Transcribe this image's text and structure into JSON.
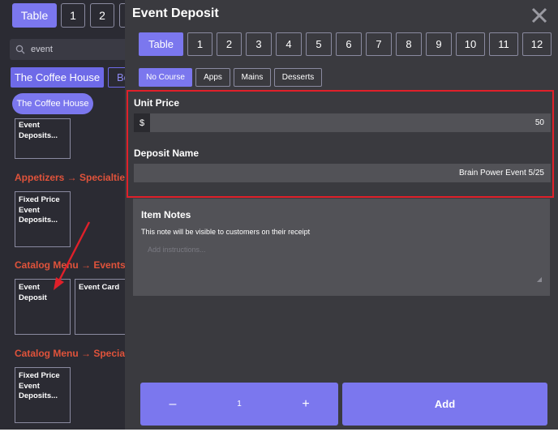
{
  "background": {
    "tabs": [
      {
        "label": "Table",
        "active": true
      },
      {
        "label": "1"
      },
      {
        "label": "2"
      }
    ],
    "search": {
      "icon": "search-icon",
      "value": "event"
    },
    "brand_button": "The Coffee House",
    "brand_button_partial": "Bo",
    "brand_pill": "The Coffee House",
    "cards": [
      {
        "label": "Event\nDeposits..."
      },
      {
        "label": "Fixed Price\nEvent\nDeposits..."
      },
      {
        "label": "Event\nDeposit"
      },
      {
        "label": "Event Card"
      },
      {
        "label": "Fixed Price\nEvent\nDeposits..."
      }
    ],
    "sections": [
      "Appetizers → Specialties",
      "Catalog Menu → Events",
      "Catalog Menu → Specialti"
    ]
  },
  "modal": {
    "title": "Event Deposit",
    "close_icon": "close-icon",
    "tabs": [
      "Table",
      "1",
      "2",
      "3",
      "4",
      "5",
      "6",
      "7",
      "8",
      "9",
      "10",
      "11",
      "12"
    ],
    "active_tab": "Table",
    "courses": [
      "No Course",
      "Apps",
      "Mains",
      "Desserts"
    ],
    "active_course": "No Course",
    "unit_price": {
      "label": "Unit Price",
      "currency": "$",
      "value": "50"
    },
    "deposit_name": {
      "label": "Deposit Name",
      "value": "Brain Power Event 5/25"
    },
    "notes": {
      "title": "Item Notes",
      "subtitle": "This note will be visible to customers on their receipt",
      "placeholder": "Add instructions..."
    },
    "quantity": {
      "minus": "–",
      "value": "1",
      "plus": "+"
    },
    "add_label": "Add"
  },
  "colors": {
    "accent": "#7b77ee",
    "highlight": "#e0202a",
    "section": "#e0533b"
  }
}
